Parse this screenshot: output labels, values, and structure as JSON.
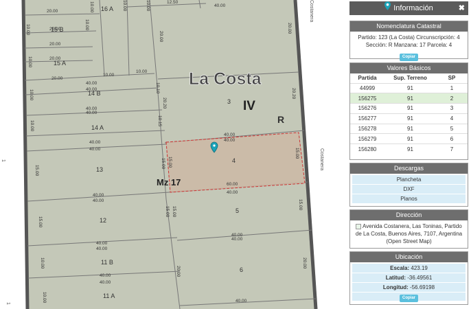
{
  "map": {
    "locality": "La Costa",
    "circ": "IV",
    "section": "R",
    "street_right": "Costanera",
    "street_top": "Costanera",
    "street_left_mark": "1",
    "manzana_label": "Mz 17",
    "parcels": [
      "16 A",
      "15 B",
      "15 A",
      "14 B",
      "14 A",
      "13",
      "12",
      "11 B",
      "11 A",
      "3",
      "4",
      "5",
      "6"
    ],
    "dims": [
      "20.00",
      "40.00",
      "10.00",
      "12.50",
      "15.00",
      "20.20",
      "10.15",
      "10.10",
      "60.00",
      "15.00"
    ]
  },
  "panel": {
    "title": "Información",
    "close": "✖",
    "nomenclatura": {
      "header": "Nomenclatura Catastral",
      "line1": "Partido: 123 (La Costa) Circunscripción: 4",
      "line2": "Sección: R Manzana: 17 Parcela: 4",
      "copy": "Copiar"
    },
    "valores": {
      "header": "Valores Básicos",
      "columns": [
        "Partida",
        "Sup. Terreno",
        "SP"
      ],
      "rows": [
        {
          "partida": "44999",
          "sup": "91",
          "sp": "1"
        },
        {
          "partida": "156275",
          "sup": "91",
          "sp": "2"
        },
        {
          "partida": "156276",
          "sup": "91",
          "sp": "3"
        },
        {
          "partida": "156277",
          "sup": "91",
          "sp": "4"
        },
        {
          "partida": "156278",
          "sup": "91",
          "sp": "5"
        },
        {
          "partida": "156279",
          "sup": "91",
          "sp": "6"
        },
        {
          "partida": "156280",
          "sup": "91",
          "sp": "7"
        }
      ]
    },
    "descargas": {
      "header": "Descargas",
      "items": [
        "Plancheta",
        "DXF",
        "Planos"
      ]
    },
    "direccion": {
      "header": "Dirección",
      "text": "Avenida Costanera, Las Toninas, Partido de La Costa, Buenos Aires, 7107, Argentina (Open Street Map)"
    },
    "ubicacion": {
      "header": "Ubicación",
      "escala_label": "Escala:",
      "escala": "423.19",
      "latitud_label": "Latitud:",
      "latitud": "-36.49561",
      "longitud_label": "Longitud:",
      "longitud": "-56.69198",
      "copy": "Copiar"
    },
    "colors": {
      "accent": "#5bc0de",
      "header": "#6e6e6e",
      "selected_row": "#dff0d8",
      "map_fill": "#c4c8b8"
    }
  }
}
